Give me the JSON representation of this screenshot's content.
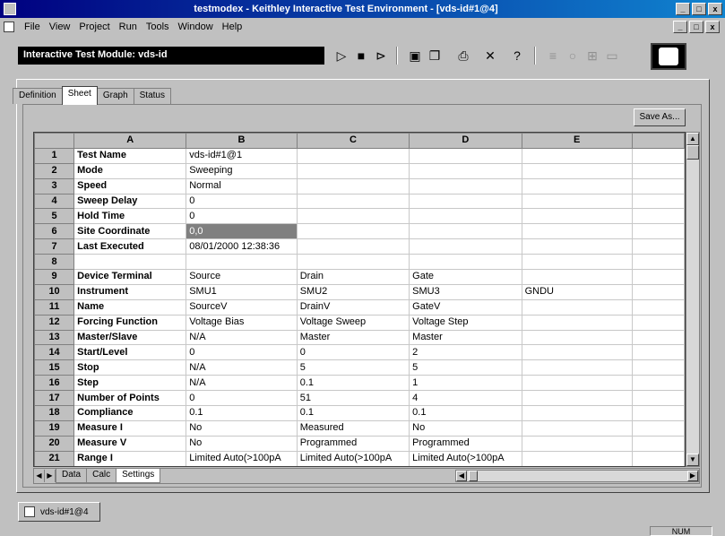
{
  "window": {
    "title": "testmodex - Keithley Interactive Test Environment - [vds-id#1@4]",
    "minimize": "_",
    "maximize": "□",
    "close": "x"
  },
  "menu": [
    "File",
    "View",
    "Project",
    "Run",
    "Tools",
    "Window",
    "Help"
  ],
  "toolbar": {
    "module_label": "Interactive Test Module: vds-id",
    "icons": [
      "run-icon",
      "stop-icon",
      "step-icon",
      "save-icon",
      "copy-icon",
      "print-icon",
      "delete-icon",
      "help-icon"
    ]
  },
  "tabs": [
    "Definition",
    "Sheet",
    "Graph",
    "Status"
  ],
  "active_tab": "Sheet",
  "save_as_label": "Save As...",
  "sheet": {
    "columns": [
      "",
      "A",
      "B",
      "C",
      "D",
      "E"
    ],
    "rows": [
      {
        "n": "1",
        "label": "Test Name",
        "b": "vds-id#1@1",
        "c": "",
        "d": "",
        "e": ""
      },
      {
        "n": "2",
        "label": "Mode",
        "b": "Sweeping",
        "c": "",
        "d": "",
        "e": ""
      },
      {
        "n": "3",
        "label": "Speed",
        "b": "Normal",
        "c": "",
        "d": "",
        "e": ""
      },
      {
        "n": "4",
        "label": "Sweep Delay",
        "b": "0",
        "c": "",
        "d": "",
        "e": ""
      },
      {
        "n": "5",
        "label": "Hold Time",
        "b": "0",
        "c": "",
        "d": "",
        "e": ""
      },
      {
        "n": "6",
        "label": "Site Coordinate",
        "b": "0,0",
        "c": "",
        "d": "",
        "e": ""
      },
      {
        "n": "7",
        "label": "Last Executed",
        "b": "08/01/2000 12:38:36",
        "c": "",
        "d": "",
        "e": ""
      },
      {
        "n": "8",
        "label": "",
        "b": "",
        "c": "",
        "d": "",
        "e": ""
      },
      {
        "n": "9",
        "label": "Device Terminal",
        "b": "Source",
        "c": "Drain",
        "d": "Gate",
        "e": ""
      },
      {
        "n": "10",
        "label": "Instrument",
        "b": "SMU1",
        "c": "SMU2",
        "d": "SMU3",
        "e": "GNDU"
      },
      {
        "n": "11",
        "label": "Name",
        "b": "SourceV",
        "c": "DrainV",
        "d": "GateV",
        "e": ""
      },
      {
        "n": "12",
        "label": "Forcing Function",
        "b": "Voltage Bias",
        "c": "Voltage Sweep",
        "d": "Voltage Step",
        "e": ""
      },
      {
        "n": "13",
        "label": "Master/Slave",
        "b": "N/A",
        "c": "Master",
        "d": "Master",
        "e": ""
      },
      {
        "n": "14",
        "label": "Start/Level",
        "b": "0",
        "c": "0",
        "d": "2",
        "e": ""
      },
      {
        "n": "15",
        "label": "Stop",
        "b": "N/A",
        "c": "5",
        "d": "5",
        "e": ""
      },
      {
        "n": "16",
        "label": "Step",
        "b": "N/A",
        "c": "0.1",
        "d": "1",
        "e": ""
      },
      {
        "n": "17",
        "label": "Number of Points",
        "b": "0",
        "c": "51",
        "d": "4",
        "e": ""
      },
      {
        "n": "18",
        "label": "Compliance",
        "b": "0.1",
        "c": "0.1",
        "d": "0.1",
        "e": ""
      },
      {
        "n": "19",
        "label": "Measure I",
        "b": "No",
        "c": "Measured",
        "d": "No",
        "e": ""
      },
      {
        "n": "20",
        "label": "Measure V",
        "b": "No",
        "c": "Programmed",
        "d": "Programmed",
        "e": ""
      },
      {
        "n": "21",
        "label": "Range I",
        "b": "Limited Auto(>100pA",
        "c": "Limited Auto(>100pA",
        "d": "Limited Auto(>100pA",
        "e": ""
      }
    ]
  },
  "sheet_tabs": [
    "Data",
    "Calc",
    "Settings"
  ],
  "active_sheet_tab": "Settings",
  "document_tab": "vds-id#1@4",
  "status": {
    "num": "NUM"
  }
}
